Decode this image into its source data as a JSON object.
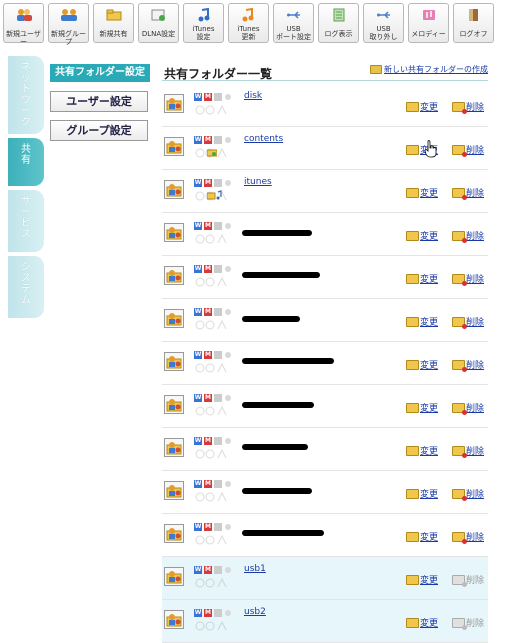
{
  "toolbar": {
    "buttons": [
      {
        "label": "新規ユーザー",
        "icon": "users-icon"
      },
      {
        "label": "新規グループ",
        "icon": "group-icon"
      },
      {
        "label": "新規共有",
        "icon": "folder-icon"
      },
      {
        "label": "DLNA設定",
        "icon": "dlna-icon"
      },
      {
        "label": "iTunes\n設定",
        "icon": "music-note-icon"
      },
      {
        "label": "iTunes\n更新",
        "icon": "music-refresh-icon"
      },
      {
        "label": "USB\nポート設定",
        "icon": "usb-icon"
      },
      {
        "label": "ログ表示",
        "icon": "log-icon"
      },
      {
        "label": "USB\n取り外し",
        "icon": "usb-eject-icon"
      },
      {
        "label": "メロディー",
        "icon": "melody-icon"
      },
      {
        "label": "ログオフ",
        "icon": "logoff-icon"
      }
    ]
  },
  "sidetabs": [
    {
      "label": "ネットワーク",
      "active": false
    },
    {
      "label": "共有",
      "active": true
    },
    {
      "label": "サービス",
      "active": false
    },
    {
      "label": "システム",
      "active": false
    }
  ],
  "submenu": {
    "active": "共有フォルダー設定",
    "items": [
      "ユーザー設定",
      "グループ設定"
    ]
  },
  "main": {
    "title": "共有フォルダー一覧",
    "new_link": "新しい共有フォルダーの作成",
    "badges": {
      "w": "W",
      "m": "M"
    },
    "change_label": "変更",
    "delete_label": "削除",
    "rows": [
      {
        "name": "disk",
        "redacted": false,
        "usb": false,
        "share_icon": "none"
      },
      {
        "name": "contents",
        "redacted": false,
        "usb": false,
        "share_icon": "folder"
      },
      {
        "name": "itunes",
        "redacted": false,
        "usb": false,
        "share_icon": "music"
      },
      {
        "name": "",
        "redacted": true,
        "usb": false,
        "share_icon": "none"
      },
      {
        "name": "",
        "redacted": true,
        "usb": false,
        "share_icon": "none"
      },
      {
        "name": "",
        "redacted": true,
        "usb": false,
        "share_icon": "none"
      },
      {
        "name": "",
        "redacted": true,
        "usb": false,
        "share_icon": "none"
      },
      {
        "name": "",
        "redacted": true,
        "usb": false,
        "share_icon": "none"
      },
      {
        "name": "",
        "redacted": true,
        "usb": false,
        "share_icon": "none"
      },
      {
        "name": "",
        "redacted": true,
        "usb": false,
        "share_icon": "none"
      },
      {
        "name": "",
        "redacted": true,
        "usb": false,
        "share_icon": "none"
      },
      {
        "name": "usb1",
        "redacted": false,
        "usb": true,
        "share_icon": "none"
      },
      {
        "name": "usb2",
        "redacted": false,
        "usb": true,
        "share_icon": "none"
      }
    ]
  },
  "colors": {
    "accent": "#2aa9b6",
    "link": "#1a3aa6",
    "usb_row_bg": "#e7f6fa"
  }
}
